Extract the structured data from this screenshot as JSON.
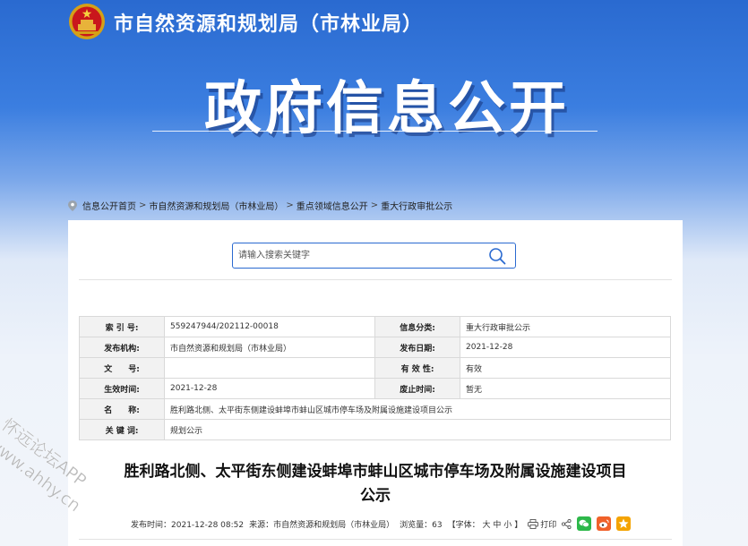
{
  "header": {
    "site_name": "市自然资源和规划局（市林业局）",
    "hero_title": "政府信息公开"
  },
  "breadcrumb": [
    "信息公开首页",
    "市自然资源和规划局（市林业局）",
    "重点领域信息公开",
    "重大行政审批公示"
  ],
  "breadcrumb_sep": ">",
  "search": {
    "placeholder": "请输入搜索关键字"
  },
  "meta_table": {
    "index_label": "索 引 号:",
    "index_value": "559247944/202112-00018",
    "category_label": "信息分类:",
    "category_value": "重大行政审批公示",
    "publisher_label": "发布机构:",
    "publisher_value": "市自然资源和规划局（市林业局）",
    "pubdate_label": "发布日期:",
    "pubdate_value": "2021-12-28",
    "docno_label": "文　　号:",
    "docno_value": "",
    "validity_label": "有 效 性:",
    "validity_value": "有效",
    "effective_label": "生效时间:",
    "effective_value": "2021-12-28",
    "expiry_label": "废止时间:",
    "expiry_value": "暂无",
    "name_label": "名　　称:",
    "name_value": "胜利路北侧、太平街东侧建设蚌埠市蚌山区城市停车场及附属设施建设项目公示",
    "keywords_label": "关 键 词:",
    "keywords_value": "规划公示"
  },
  "article": {
    "title_line1": "胜利路北侧、太平街东侧建设蚌埠市蚌山区城市停车场及附属设施建设项目",
    "title_line2": "公示",
    "time_label": "发布时间：",
    "time_value": "2021-12-28 08:52",
    "source_label": "来源：",
    "source_value": "市自然资源和规划局（市林业局）",
    "views_label": "浏览量：",
    "views_value": "63",
    "font_label": "【字体：",
    "font_large": "大",
    "font_medium": "中",
    "font_small": "小",
    "font_close": "】",
    "print_label": "打印"
  },
  "watermark": {
    "line1": "怀远论坛APP",
    "line2": "www.ahhy.cn"
  },
  "colors": {
    "primary_blue": "#2a6ad0",
    "wechat_green": "#2db84a",
    "weibo_orange": "#f0612a",
    "star_orange": "#f4a300"
  }
}
